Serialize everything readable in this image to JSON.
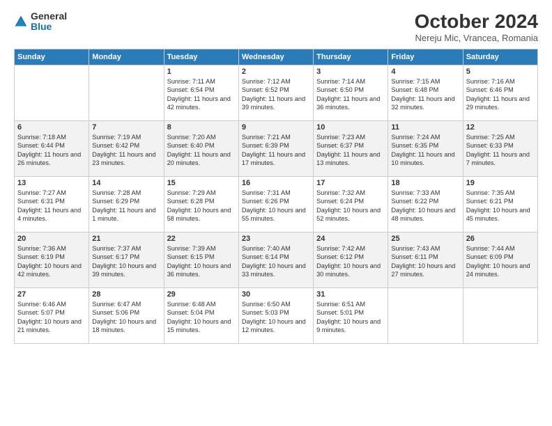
{
  "header": {
    "logo_general": "General",
    "logo_blue": "Blue",
    "month_title": "October 2024",
    "subtitle": "Nereju Mic, Vrancea, Romania"
  },
  "days_of_week": [
    "Sunday",
    "Monday",
    "Tuesday",
    "Wednesday",
    "Thursday",
    "Friday",
    "Saturday"
  ],
  "weeks": [
    [
      {
        "day": "",
        "info": ""
      },
      {
        "day": "",
        "info": ""
      },
      {
        "day": "1",
        "sunrise": "Sunrise: 7:11 AM",
        "sunset": "Sunset: 6:54 PM",
        "daylight": "Daylight: 11 hours and 42 minutes."
      },
      {
        "day": "2",
        "sunrise": "Sunrise: 7:12 AM",
        "sunset": "Sunset: 6:52 PM",
        "daylight": "Daylight: 11 hours and 39 minutes."
      },
      {
        "day": "3",
        "sunrise": "Sunrise: 7:14 AM",
        "sunset": "Sunset: 6:50 PM",
        "daylight": "Daylight: 11 hours and 36 minutes."
      },
      {
        "day": "4",
        "sunrise": "Sunrise: 7:15 AM",
        "sunset": "Sunset: 6:48 PM",
        "daylight": "Daylight: 11 hours and 32 minutes."
      },
      {
        "day": "5",
        "sunrise": "Sunrise: 7:16 AM",
        "sunset": "Sunset: 6:46 PM",
        "daylight": "Daylight: 11 hours and 29 minutes."
      }
    ],
    [
      {
        "day": "6",
        "sunrise": "Sunrise: 7:18 AM",
        "sunset": "Sunset: 6:44 PM",
        "daylight": "Daylight: 11 hours and 26 minutes."
      },
      {
        "day": "7",
        "sunrise": "Sunrise: 7:19 AM",
        "sunset": "Sunset: 6:42 PM",
        "daylight": "Daylight: 11 hours and 23 minutes."
      },
      {
        "day": "8",
        "sunrise": "Sunrise: 7:20 AM",
        "sunset": "Sunset: 6:40 PM",
        "daylight": "Daylight: 11 hours and 20 minutes."
      },
      {
        "day": "9",
        "sunrise": "Sunrise: 7:21 AM",
        "sunset": "Sunset: 6:39 PM",
        "daylight": "Daylight: 11 hours and 17 minutes."
      },
      {
        "day": "10",
        "sunrise": "Sunrise: 7:23 AM",
        "sunset": "Sunset: 6:37 PM",
        "daylight": "Daylight: 11 hours and 13 minutes."
      },
      {
        "day": "11",
        "sunrise": "Sunrise: 7:24 AM",
        "sunset": "Sunset: 6:35 PM",
        "daylight": "Daylight: 11 hours and 10 minutes."
      },
      {
        "day": "12",
        "sunrise": "Sunrise: 7:25 AM",
        "sunset": "Sunset: 6:33 PM",
        "daylight": "Daylight: 11 hours and 7 minutes."
      }
    ],
    [
      {
        "day": "13",
        "sunrise": "Sunrise: 7:27 AM",
        "sunset": "Sunset: 6:31 PM",
        "daylight": "Daylight: 11 hours and 4 minutes."
      },
      {
        "day": "14",
        "sunrise": "Sunrise: 7:28 AM",
        "sunset": "Sunset: 6:29 PM",
        "daylight": "Daylight: 11 hours and 1 minute."
      },
      {
        "day": "15",
        "sunrise": "Sunrise: 7:29 AM",
        "sunset": "Sunset: 6:28 PM",
        "daylight": "Daylight: 10 hours and 58 minutes."
      },
      {
        "day": "16",
        "sunrise": "Sunrise: 7:31 AM",
        "sunset": "Sunset: 6:26 PM",
        "daylight": "Daylight: 10 hours and 55 minutes."
      },
      {
        "day": "17",
        "sunrise": "Sunrise: 7:32 AM",
        "sunset": "Sunset: 6:24 PM",
        "daylight": "Daylight: 10 hours and 52 minutes."
      },
      {
        "day": "18",
        "sunrise": "Sunrise: 7:33 AM",
        "sunset": "Sunset: 6:22 PM",
        "daylight": "Daylight: 10 hours and 48 minutes."
      },
      {
        "day": "19",
        "sunrise": "Sunrise: 7:35 AM",
        "sunset": "Sunset: 6:21 PM",
        "daylight": "Daylight: 10 hours and 45 minutes."
      }
    ],
    [
      {
        "day": "20",
        "sunrise": "Sunrise: 7:36 AM",
        "sunset": "Sunset: 6:19 PM",
        "daylight": "Daylight: 10 hours and 42 minutes."
      },
      {
        "day": "21",
        "sunrise": "Sunrise: 7:37 AM",
        "sunset": "Sunset: 6:17 PM",
        "daylight": "Daylight: 10 hours and 39 minutes."
      },
      {
        "day": "22",
        "sunrise": "Sunrise: 7:39 AM",
        "sunset": "Sunset: 6:15 PM",
        "daylight": "Daylight: 10 hours and 36 minutes."
      },
      {
        "day": "23",
        "sunrise": "Sunrise: 7:40 AM",
        "sunset": "Sunset: 6:14 PM",
        "daylight": "Daylight: 10 hours and 33 minutes."
      },
      {
        "day": "24",
        "sunrise": "Sunrise: 7:42 AM",
        "sunset": "Sunset: 6:12 PM",
        "daylight": "Daylight: 10 hours and 30 minutes."
      },
      {
        "day": "25",
        "sunrise": "Sunrise: 7:43 AM",
        "sunset": "Sunset: 6:11 PM",
        "daylight": "Daylight: 10 hours and 27 minutes."
      },
      {
        "day": "26",
        "sunrise": "Sunrise: 7:44 AM",
        "sunset": "Sunset: 6:09 PM",
        "daylight": "Daylight: 10 hours and 24 minutes."
      }
    ],
    [
      {
        "day": "27",
        "sunrise": "Sunrise: 6:46 AM",
        "sunset": "Sunset: 5:07 PM",
        "daylight": "Daylight: 10 hours and 21 minutes."
      },
      {
        "day": "28",
        "sunrise": "Sunrise: 6:47 AM",
        "sunset": "Sunset: 5:06 PM",
        "daylight": "Daylight: 10 hours and 18 minutes."
      },
      {
        "day": "29",
        "sunrise": "Sunrise: 6:48 AM",
        "sunset": "Sunset: 5:04 PM",
        "daylight": "Daylight: 10 hours and 15 minutes."
      },
      {
        "day": "30",
        "sunrise": "Sunrise: 6:50 AM",
        "sunset": "Sunset: 5:03 PM",
        "daylight": "Daylight: 10 hours and 12 minutes."
      },
      {
        "day": "31",
        "sunrise": "Sunrise: 6:51 AM",
        "sunset": "Sunset: 5:01 PM",
        "daylight": "Daylight: 10 hours and 9 minutes."
      },
      {
        "day": "",
        "info": ""
      },
      {
        "day": "",
        "info": ""
      }
    ]
  ]
}
